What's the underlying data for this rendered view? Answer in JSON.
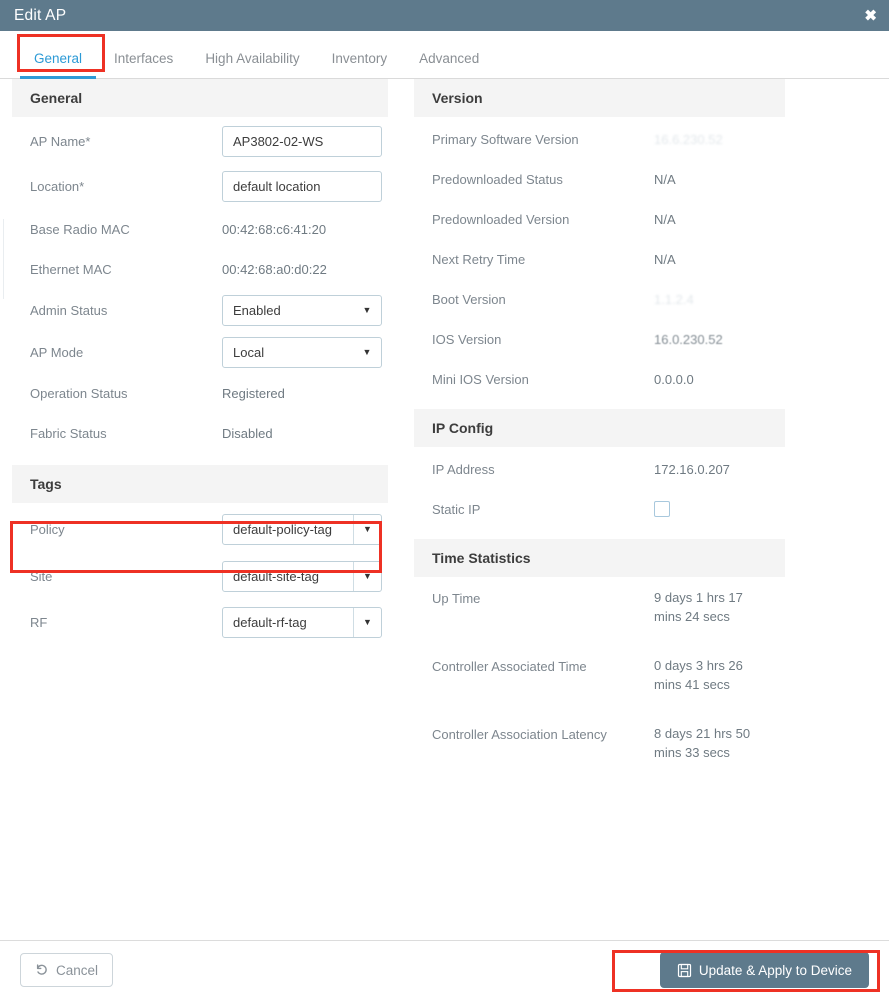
{
  "window": {
    "title": "Edit AP",
    "close_icon": "close-icon"
  },
  "tabs": [
    {
      "label": "General",
      "active": true
    },
    {
      "label": "Interfaces",
      "active": false
    },
    {
      "label": "High Availability",
      "active": false
    },
    {
      "label": "Inventory",
      "active": false
    },
    {
      "label": "Advanced",
      "active": false
    }
  ],
  "left": {
    "general": {
      "heading": "General",
      "ap_name_label": "AP Name*",
      "ap_name_value": "AP3802-02-WS",
      "location_label": "Location*",
      "location_value": "default location",
      "base_radio_mac_label": "Base Radio MAC",
      "base_radio_mac_value": "00:42:68:c6:41:20",
      "ethernet_mac_label": "Ethernet MAC",
      "ethernet_mac_value": "00:42:68:a0:d0:22",
      "admin_status_label": "Admin Status",
      "admin_status_value": "Enabled",
      "ap_mode_label": "AP Mode",
      "ap_mode_value": "Local",
      "operation_status_label": "Operation Status",
      "operation_status_value": "Registered",
      "fabric_status_label": "Fabric Status",
      "fabric_status_value": "Disabled"
    },
    "tags": {
      "heading": "Tags",
      "policy_label": "Policy",
      "policy_value": "default-policy-tag",
      "site_label": "Site",
      "site_value": "default-site-tag",
      "rf_label": "RF",
      "rf_value": "default-rf-tag"
    }
  },
  "right": {
    "version": {
      "heading": "Version",
      "primary_software_label": "Primary Software Version",
      "primary_software_value": "16.6.230.52",
      "predownloaded_status_label": "Predownloaded Status",
      "predownloaded_status_value": "N/A",
      "predownloaded_version_label": "Predownloaded Version",
      "predownloaded_version_value": "N/A",
      "next_retry_label": "Next Retry Time",
      "next_retry_value": "N/A",
      "boot_version_label": "Boot Version",
      "boot_version_value": "1.1.2.4",
      "ios_version_label": "IOS Version",
      "ios_version_value": "16.0.230.52",
      "mini_ios_label": "Mini IOS Version",
      "mini_ios_value": "0.0.0.0"
    },
    "ip_config": {
      "heading": "IP Config",
      "ip_address_label": "IP Address",
      "ip_address_value": "172.16.0.207",
      "static_ip_label": "Static IP",
      "static_ip_checked": false
    },
    "time_statistics": {
      "heading": "Time Statistics",
      "up_time_label": "Up Time",
      "up_time_value": "9 days 1 hrs 17 mins 24 secs",
      "controller_associated_label": "Controller Associated Time",
      "controller_associated_value": "0 days 3 hrs 26 mins 41 secs",
      "controller_latency_label": "Controller Association Latency",
      "controller_latency_value": "8 days 21 hrs 50 mins 33 secs"
    }
  },
  "footer": {
    "cancel_label": "Cancel",
    "cancel_icon": "undo-arrow-icon",
    "update_label": "Update & Apply to Device",
    "update_icon": "save-floppy-icon"
  },
  "colors": {
    "header_bg": "#5e7a8c",
    "accent_blue": "#2c9ad6",
    "annotation_red": "#ee3124",
    "primary_button": "#5e7a8c"
  }
}
